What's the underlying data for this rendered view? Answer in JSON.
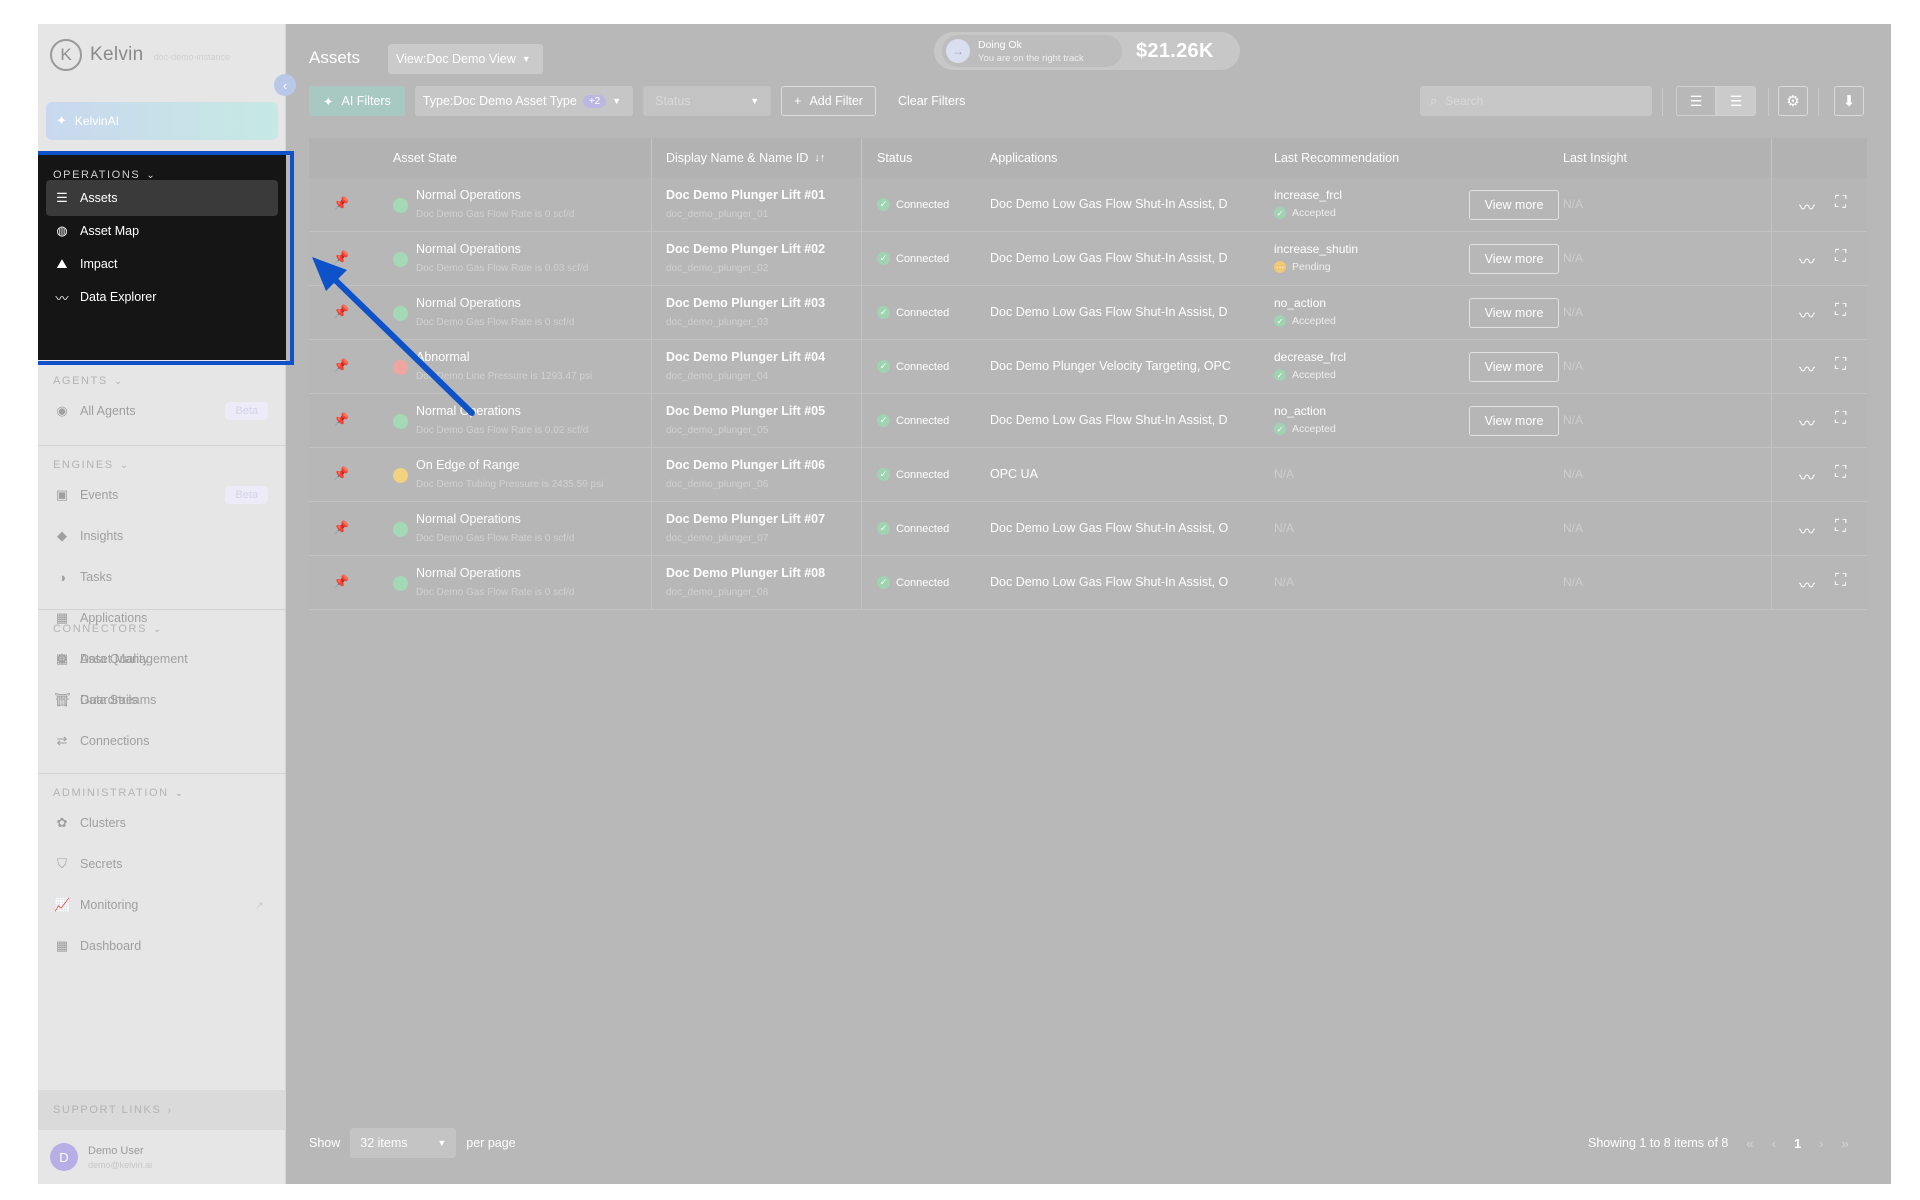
{
  "app": {
    "logo_mark": "K",
    "name": "Kelvin",
    "subtitle": "doc-demo-instance",
    "collapse_icon": "chevron-left-icon",
    "ai_label": "KelvinAI"
  },
  "sidebar": {
    "operations": {
      "title": "OPERATIONS",
      "items": [
        {
          "label": "Assets",
          "icon": "layers-icon",
          "glyph": "☰"
        },
        {
          "label": "Asset Map",
          "icon": "globe-icon",
          "glyph": "◍"
        },
        {
          "label": "Impact",
          "icon": "area-chart-icon",
          "glyph": "⛰"
        },
        {
          "label": "Data Explorer",
          "icon": "pulse-icon",
          "glyph": "〰"
        }
      ]
    },
    "agents": {
      "title": "AGENTS",
      "items": [
        {
          "label": "All Agents",
          "icon": "agent-icon",
          "glyph": "◉",
          "badge": "Beta"
        }
      ]
    },
    "engines": {
      "title": "ENGINES",
      "items": [
        {
          "label": "Events",
          "icon": "events-icon",
          "glyph": "▣",
          "badge": "Beta"
        },
        {
          "label": "Insights",
          "icon": "tag-icon",
          "glyph": "◆"
        },
        {
          "label": "Tasks",
          "icon": "tasks-icon",
          "glyph": "◑"
        },
        {
          "label": "Applications",
          "icon": "grid-icon",
          "glyph": "▦"
        },
        {
          "label": "Data Quality",
          "icon": "gear-icon",
          "glyph": "⚙"
        },
        {
          "label": "Guardrails",
          "icon": "guardrail-icon",
          "glyph": "⛩"
        }
      ]
    },
    "connectors": {
      "title": "CONNECTORS",
      "items": [
        {
          "label": "Asset Management",
          "icon": "asset-management-icon",
          "glyph": "▦"
        },
        {
          "label": "Data Streams",
          "icon": "bar-chart-icon",
          "glyph": "▥"
        },
        {
          "label": "Connections",
          "icon": "connections-icon",
          "glyph": "⇄"
        }
      ]
    },
    "administration": {
      "title": "ADMINISTRATION",
      "items": [
        {
          "label": "Clusters",
          "icon": "clusters-icon",
          "glyph": "✿"
        },
        {
          "label": "Secrets",
          "icon": "shield-icon",
          "glyph": "⛉"
        },
        {
          "label": "Monitoring",
          "icon": "monitoring-icon",
          "glyph": "📈",
          "external": "↗"
        },
        {
          "label": "Dashboard",
          "icon": "dashboard-icon",
          "glyph": "▦"
        }
      ]
    },
    "support": {
      "title": "SUPPORT LINKS"
    },
    "user": {
      "initial": "D",
      "name": "Demo User",
      "email": "demo@kelvin.ai"
    }
  },
  "header": {
    "title": "Assets",
    "view_label": "View:",
    "view_value": "Doc Demo View",
    "status_title": "Doing Ok",
    "status_sub": "You are on the right track",
    "money": "$21.26K"
  },
  "filters": {
    "ai": "AI Filters",
    "type_label": "Type:",
    "type_value": "Doc Demo Asset Type",
    "type_more": "+2",
    "status": "Status",
    "add": "Add Filter",
    "clear": "Clear Filters",
    "search_placeholder": "Search"
  },
  "table": {
    "headers": [
      "Asset State",
      "Display Name & Name ID",
      "Status",
      "Applications",
      "Last Recommendation",
      "Last Insight"
    ],
    "sort_icon": "↓↑",
    "view_more": "View more",
    "rows": [
      {
        "state": "Normal Operations",
        "state_detail": "Doc Demo Gas Flow Rate is 0 scf/d",
        "dot_color": "#a3d9b5",
        "name": "Doc Demo Plunger Lift #01",
        "name_id": "doc_demo_plunger_01",
        "status": "Connected",
        "apps": "Doc Demo Low Gas Flow Shut-In Assist, D",
        "rec": "increase_frcl",
        "rec_status": "Accepted",
        "rec_color": "#9fd3b2",
        "insight": "N/A"
      },
      {
        "state": "Normal Operations",
        "state_detail": "Doc Demo Gas Flow Rate is 0.03 scf/d",
        "dot_color": "#a3d9b5",
        "name": "Doc Demo Plunger Lift #02",
        "name_id": "doc_demo_plunger_02",
        "status": "Connected",
        "apps": "Doc Demo Low Gas Flow Shut-In Assist, D",
        "rec": "increase_shutin",
        "rec_status": "Pending",
        "rec_color": "#f0c977",
        "insight": "N/A"
      },
      {
        "state": "Normal Operations",
        "state_detail": "Doc Demo Gas Flow Rate is 0 scf/d",
        "dot_color": "#a3d9b5",
        "name": "Doc Demo Plunger Lift #03",
        "name_id": "doc_demo_plunger_03",
        "status": "Connected",
        "apps": "Doc Demo Low Gas Flow Shut-In Assist, D",
        "rec": "no_action",
        "rec_status": "Accepted",
        "rec_color": "#9fd3b2",
        "insight": "N/A"
      },
      {
        "state": "Abnormal",
        "state_detail": "Doc Demo Line Pressure is 1293.47 psi",
        "dot_color": "#f0a6a0",
        "name": "Doc Demo Plunger Lift #04",
        "name_id": "doc_demo_plunger_04",
        "status": "Connected",
        "apps": "Doc Demo Plunger Velocity Targeting, OPC",
        "rec": "decrease_frcl",
        "rec_status": "Accepted",
        "rec_color": "#9fd3b2",
        "insight": "N/A"
      },
      {
        "state": "Normal Operations",
        "state_detail": "Doc Demo Gas Flow Rate is 0.02 scf/d",
        "dot_color": "#a3d9b5",
        "name": "Doc Demo Plunger Lift #05",
        "name_id": "doc_demo_plunger_05",
        "status": "Connected",
        "apps": "Doc Demo Low Gas Flow Shut-In Assist, D",
        "rec": "no_action",
        "rec_status": "Accepted",
        "rec_color": "#9fd3b2",
        "insight": "N/A"
      },
      {
        "state": "On Edge of Range",
        "state_detail": "Doc Demo Tubing Pressure is 2435.59 psi",
        "dot_color": "#f3d27f",
        "name": "Doc Demo Plunger Lift #06",
        "name_id": "doc_demo_plunger_06",
        "status": "Connected",
        "apps": "OPC UA",
        "rec": "",
        "rec_status": "",
        "rec_na": "N/A",
        "insight": "N/A"
      },
      {
        "state": "Normal Operations",
        "state_detail": "Doc Demo Gas Flow Rate is 0 scf/d",
        "dot_color": "#a3d9b5",
        "name": "Doc Demo Plunger Lift #07",
        "name_id": "doc_demo_plunger_07",
        "status": "Connected",
        "apps": "Doc Demo Low Gas Flow Shut-In Assist, O",
        "rec": "",
        "rec_status": "",
        "rec_na": "N/A",
        "insight": "N/A"
      },
      {
        "state": "Normal Operations",
        "state_detail": "Doc Demo Gas Flow Rate is 0 scf/d",
        "dot_color": "#a3d9b5",
        "name": "Doc Demo Plunger Lift #08",
        "name_id": "doc_demo_plunger_08",
        "status": "Connected",
        "apps": "Doc Demo Low Gas Flow Shut-In Assist, O",
        "rec": "",
        "rec_status": "",
        "rec_na": "N/A",
        "insight": "N/A"
      }
    ]
  },
  "pagination": {
    "show": "Show",
    "per_value": "32 items",
    "per_page": "per page",
    "summary": "Showing 1 to 8 items of 8",
    "current": "1"
  },
  "colors": {
    "highlight": "#0d52c9",
    "arrow": "#0d52c9"
  }
}
